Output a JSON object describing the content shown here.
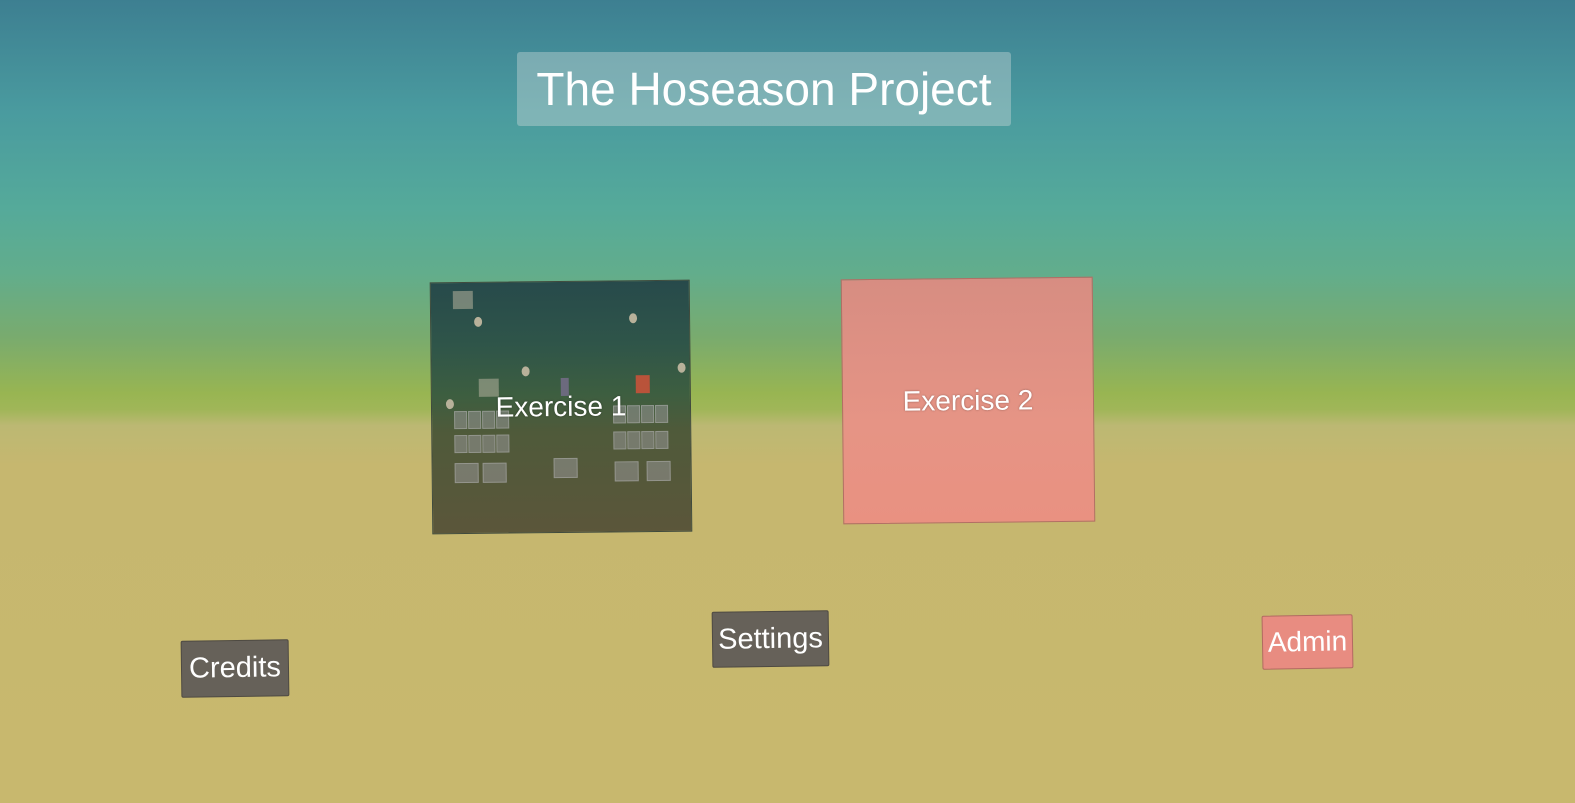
{
  "title": "The Hoseason Project",
  "exercises": [
    {
      "label": "Exercise 1"
    },
    {
      "label": "Exercise 2"
    }
  ],
  "buttons": {
    "credits": "Credits",
    "settings": "Settings",
    "admin": "Admin"
  },
  "colors": {
    "sky_top": "#3d7f91",
    "horizon": "#98b552",
    "ground": "#c8b86e",
    "dark_button": "#666159",
    "pink_accent": "#e88c81"
  }
}
